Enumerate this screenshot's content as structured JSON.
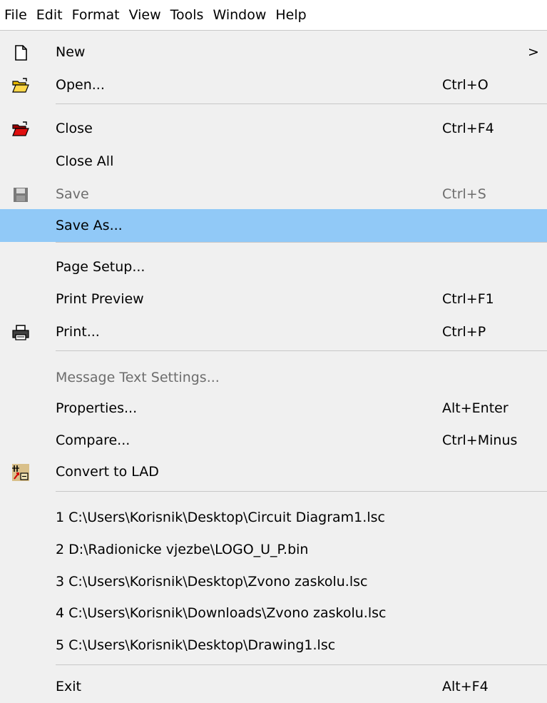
{
  "menubar": [
    "File",
    "Edit",
    "Format",
    "View",
    "Tools",
    "Window",
    "Help"
  ],
  "menu": {
    "new": {
      "label": "New",
      "arrow": ">"
    },
    "open": {
      "label": "Open...",
      "shortcut": "Ctrl+O"
    },
    "close": {
      "label": "Close",
      "shortcut": "Ctrl+F4"
    },
    "close_all": {
      "label": "Close All"
    },
    "save": {
      "label": "Save",
      "shortcut": "Ctrl+S"
    },
    "save_as": {
      "label": "Save As..."
    },
    "page_setup": {
      "label": "Page Setup..."
    },
    "print_preview": {
      "label": "Print Preview",
      "shortcut": "Ctrl+F1"
    },
    "print": {
      "label": "Print...",
      "shortcut": "Ctrl+P"
    },
    "message_text": {
      "label": "Message Text Settings..."
    },
    "properties": {
      "label": "Properties...",
      "shortcut": "Alt+Enter"
    },
    "compare": {
      "label": "Compare...",
      "shortcut": "Ctrl+Minus"
    },
    "convert": {
      "label": "Convert to LAD"
    },
    "recent": [
      "1 C:\\Users\\Korisnik\\Desktop\\Circuit Diagram1.lsc",
      "2 D:\\Radionicke vjezbe\\LOGO_U_P.bin",
      "3 C:\\Users\\Korisnik\\Desktop\\Zvono zaskolu.lsc",
      "4 C:\\Users\\Korisnik\\Downloads\\Zvono zaskolu.lsc",
      "5 C:\\Users\\Korisnik\\Desktop\\Drawing1.lsc"
    ],
    "exit": {
      "label": "Exit",
      "shortcut": "Alt+F4"
    }
  },
  "colors": {
    "highlight": "#91c9f7",
    "disabled_text": "#6d6d6d",
    "menu_bg": "#f0f0f0",
    "separator": "#c8c8c8"
  },
  "icons": {
    "new": "new-document-icon",
    "open": "open-folder-icon",
    "close": "close-folder-icon",
    "save": "save-disk-icon",
    "print": "printer-icon",
    "convert": "convert-lad-icon"
  }
}
